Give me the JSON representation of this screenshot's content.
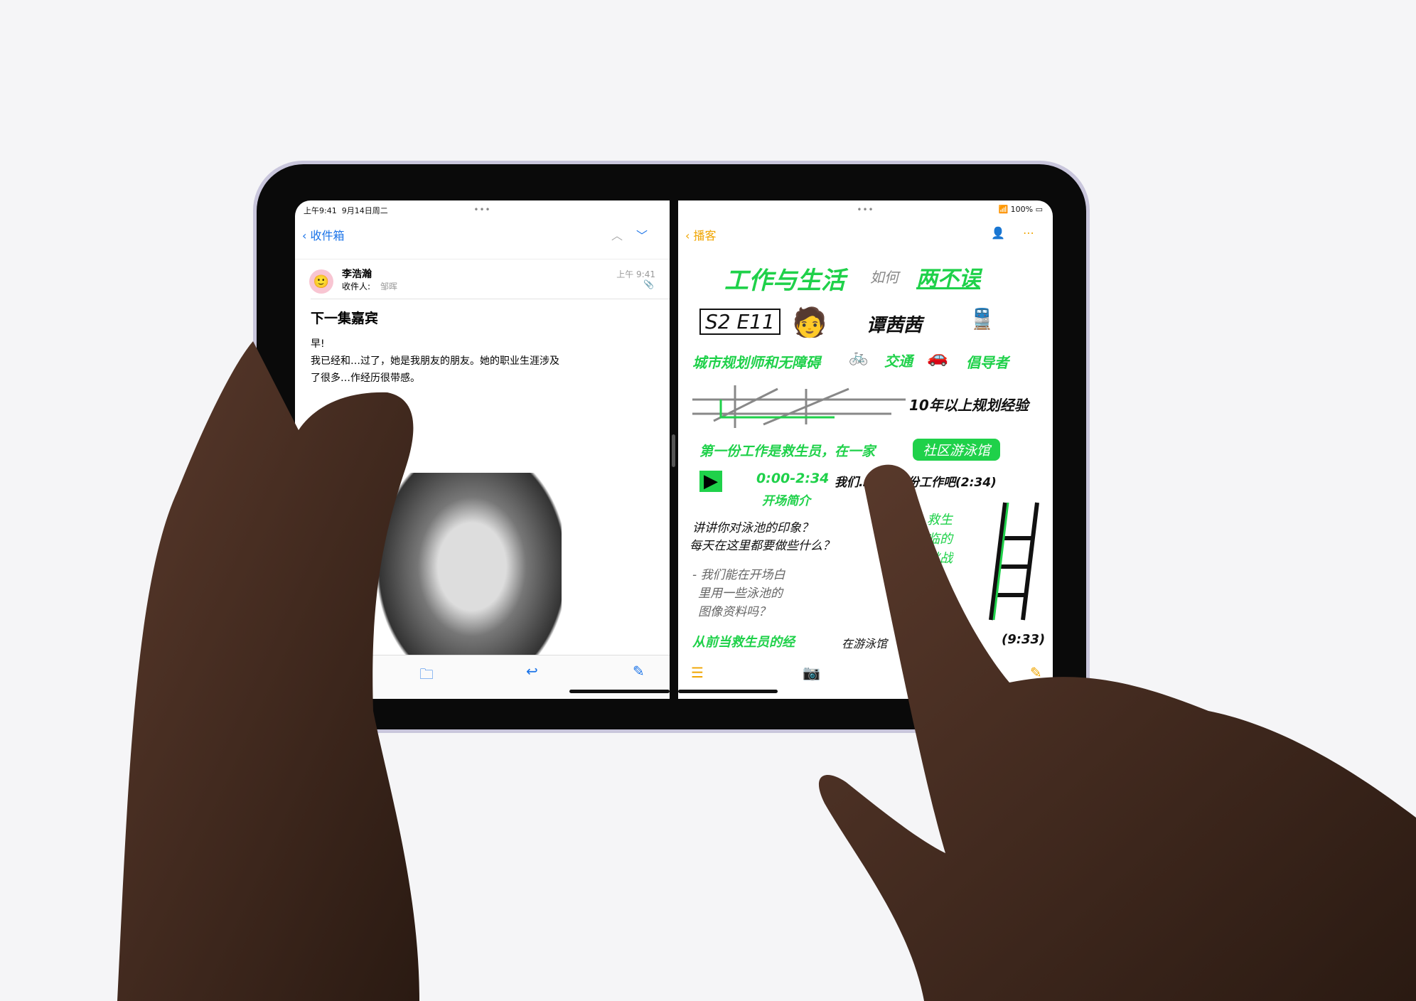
{
  "status": {
    "time": "上午9:41",
    "date": "9月14日周二",
    "battery": "100%",
    "multitask_dots": "•••"
  },
  "mail": {
    "back_label": "收件箱",
    "sender": "李浩瀚",
    "to_label": "收件人:",
    "recipient": "邹晖",
    "time": "上午 9:41",
    "subject": "下一集嘉宾",
    "body": [
      "早!",
      "我已经和…过了，她是我朋友的朋友。她的职业生涯涉及",
      "了很多…作经历很带感。"
    ]
  },
  "notes": {
    "back_label": "播客",
    "title": "工作与生活",
    "title_mid": "如何",
    "title_end": "两不误",
    "episode": "S2 E11",
    "guest": "谭茜茜",
    "role": "城市规划师和无障碍",
    "role2": "交通",
    "role3": "倡导者",
    "experience": "10年以上规划经验",
    "first_job": "第一份工作是救生员，在一家",
    "pool": "社区游泳馆",
    "timecode": "0:00-2:34",
    "intro": "开场简介",
    "q1": "我们…的第一份工作吧(2:34)",
    "q2": "讲讲你对泳池的印象？",
    "q3": "每天在这里都要做些什么？",
    "n1": "- 我们能在开场白",
    "n2": "里用一些泳池的",
    "n3": "图像资料吗？",
    "n4": "从前当救生员的经",
    "n5": "在游泳馆",
    "n6": "(9:33)",
    "side1": "救生",
    "side2": "临的",
    "side3": "挑战"
  },
  "colors": {
    "mail_accent": "#1a73e8",
    "notes_accent": "#f0a500",
    "sketch_green": "#1fd14a"
  }
}
